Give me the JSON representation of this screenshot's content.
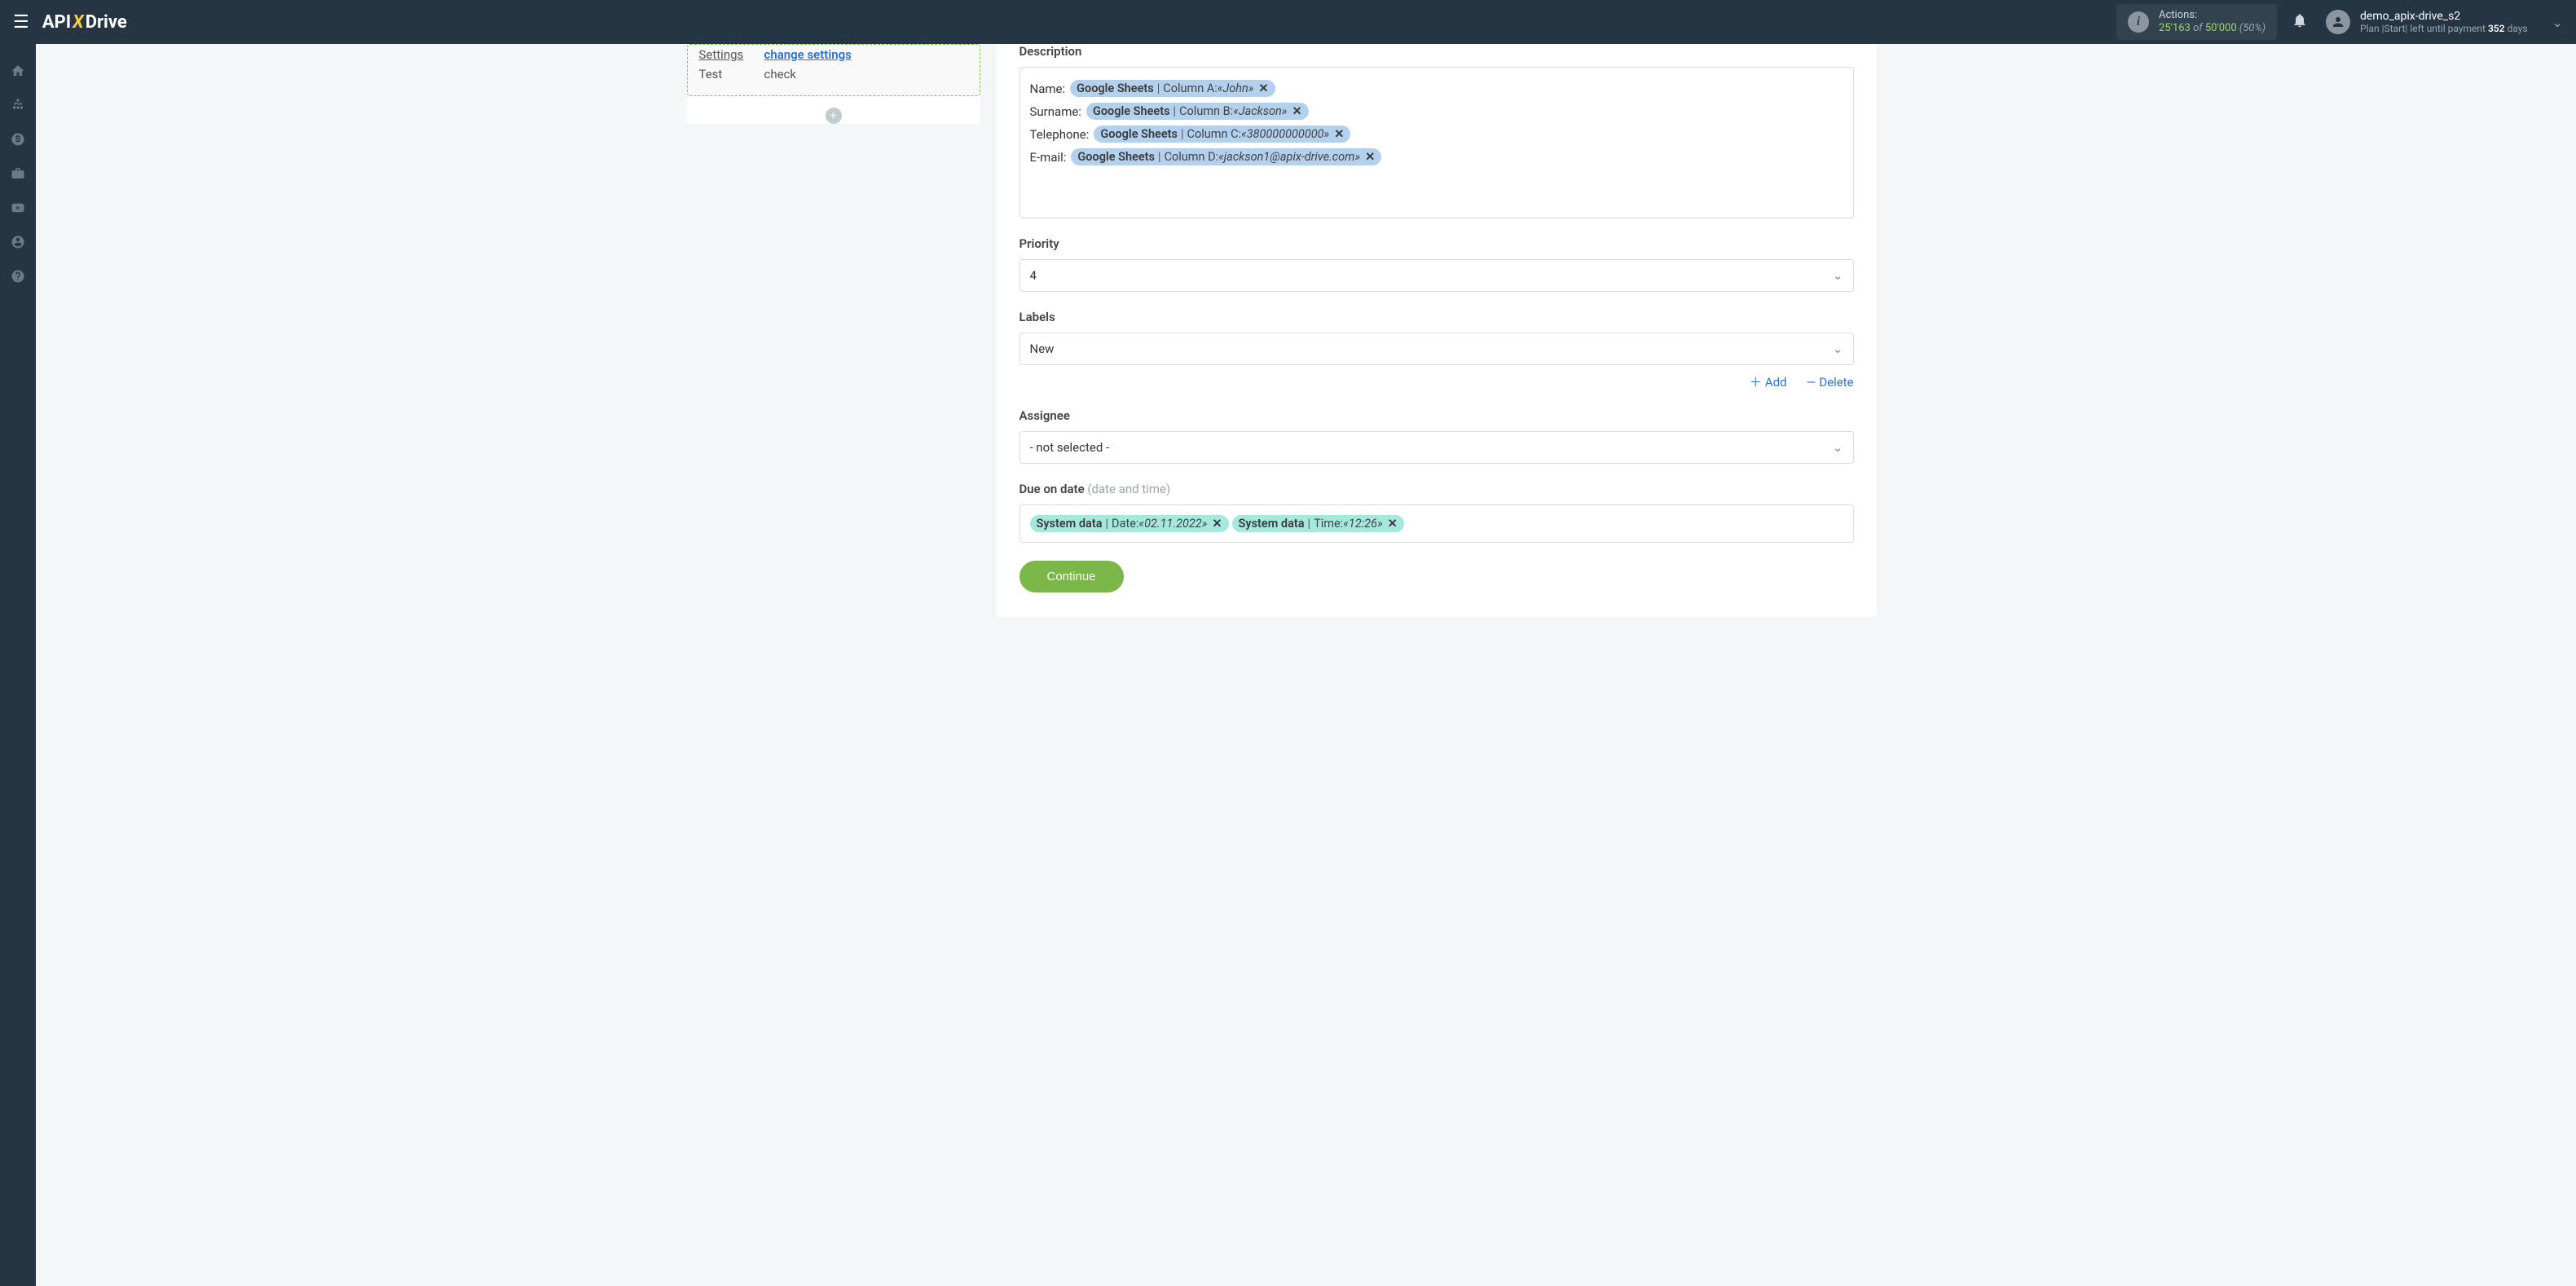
{
  "header": {
    "logo_pre": "API",
    "logo_x": "X",
    "logo_post": "Drive",
    "actions_label": "Actions:",
    "actions_used": "25'163",
    "actions_of": "of",
    "actions_total": "50'000",
    "actions_pct": "(50%)",
    "user_name": "demo_apix-drive_s2",
    "plan_line_pre": "Plan |Start| left until payment ",
    "plan_days": "352",
    "plan_days_suffix": " days"
  },
  "left": {
    "rows": [
      {
        "label": "Settings",
        "value": "change settings",
        "link": true,
        "underline": true
      },
      {
        "label": "Test",
        "value": "check",
        "link": false,
        "underline": false
      }
    ]
  },
  "form": {
    "description_label": "Description",
    "desc_lines": [
      {
        "prefix": "Name:",
        "src": "Google Sheets",
        "col": "Column A:",
        "val": "«John»"
      },
      {
        "prefix": "Surname:",
        "src": "Google Sheets",
        "col": "Column B:",
        "val": "«Jackson»"
      },
      {
        "prefix": "Telephone:",
        "src": "Google Sheets",
        "col": "Column C:",
        "val": "«380000000000»"
      },
      {
        "prefix": "E-mail:",
        "src": "Google Sheets",
        "col": "Column D:",
        "val": "«jackson1@apix-drive.com»"
      }
    ],
    "priority_label": "Priority",
    "priority_value": "4",
    "labels_label": "Labels",
    "labels_value": "New",
    "add_label": "Add",
    "delete_label": "Delete",
    "assignee_label": "Assignee",
    "assignee_value": "- not selected -",
    "due_label": "Due on date",
    "due_hint": "(date and time)",
    "due_tags": [
      {
        "src": "System data",
        "col": "Date:",
        "val": "«02.11.2022»"
      },
      {
        "src": "System data",
        "col": "Time:",
        "val": "«12:26»"
      }
    ],
    "continue": "Continue"
  }
}
